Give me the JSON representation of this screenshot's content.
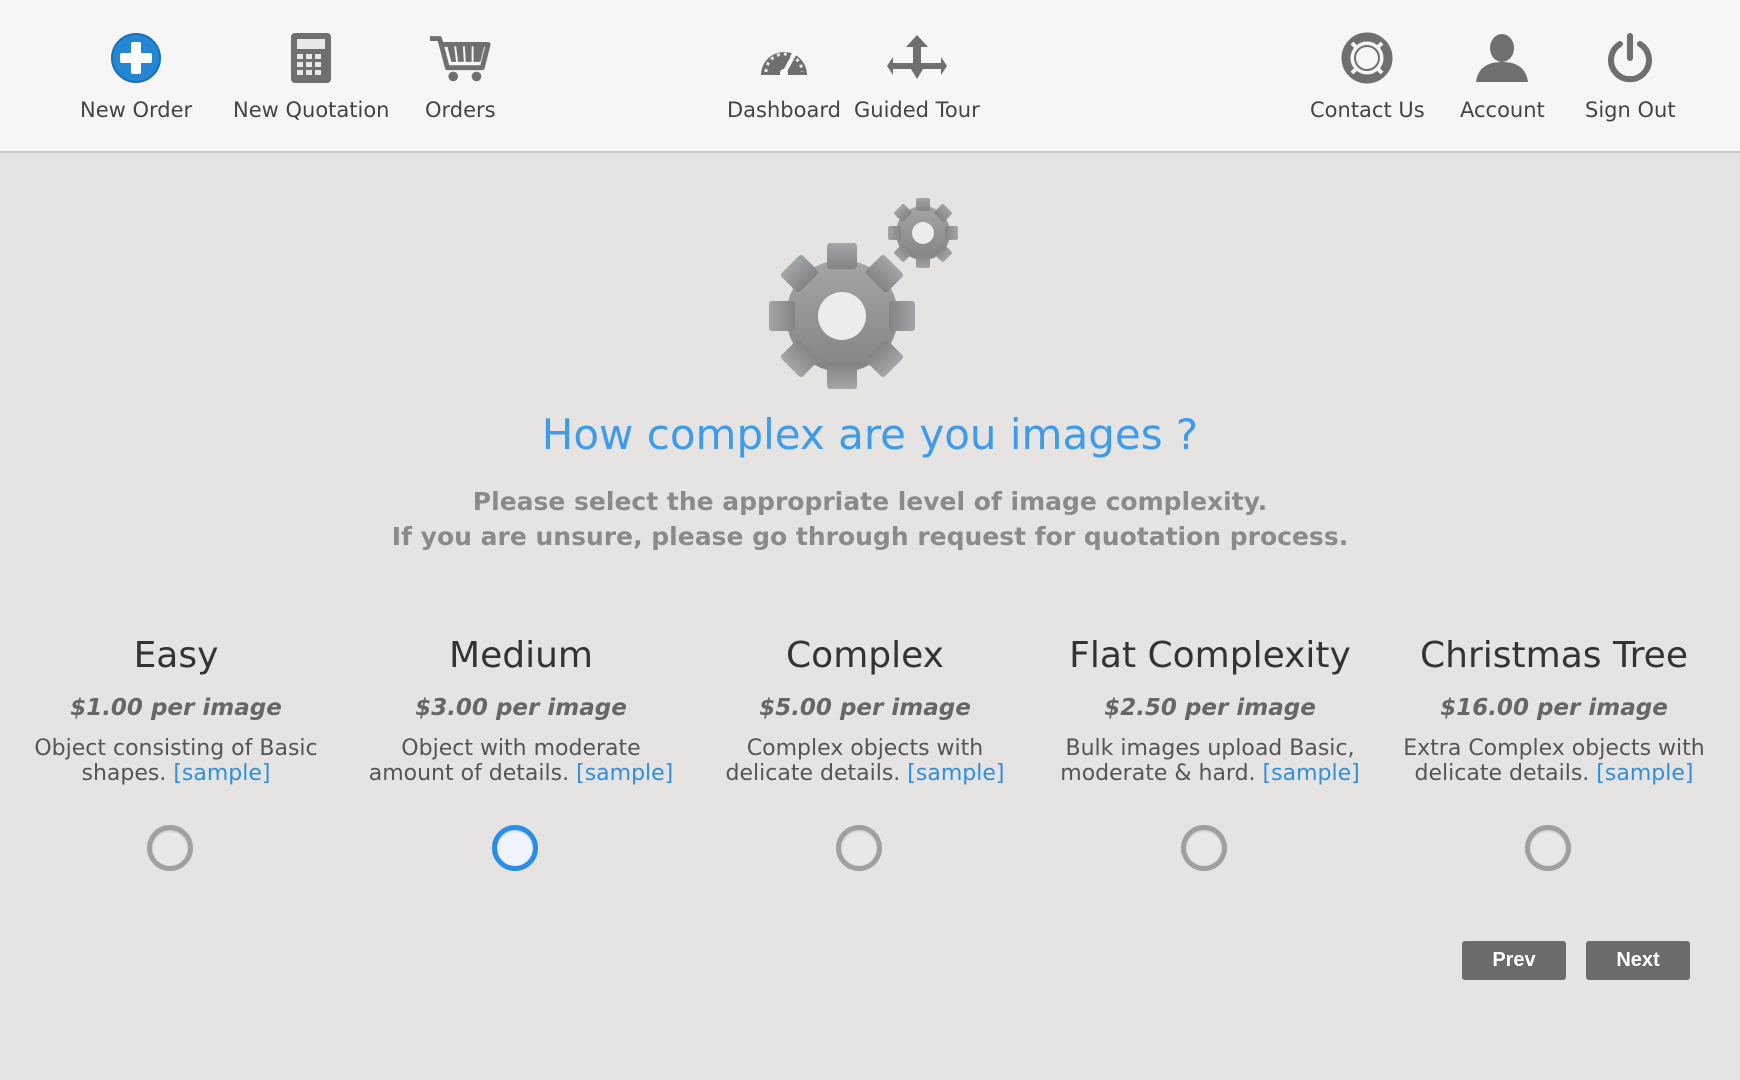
{
  "nav": {
    "new_order": "New Order",
    "new_quotation": "New Quotation",
    "orders": "Orders",
    "dashboard": "Dashboard",
    "guided_tour": "Guided Tour",
    "contact_us": "Contact Us",
    "account": "Account",
    "sign_out": "Sign Out"
  },
  "icons": {
    "new_order": "plus-circle-icon",
    "new_quotation": "calculator-icon",
    "orders": "shopping-cart-icon",
    "dashboard": "speedometer-icon",
    "guided_tour": "move-arrows-icon",
    "contact_us": "lifebuoy-icon",
    "account": "user-icon",
    "sign_out": "power-icon",
    "hero": "gears-icon"
  },
  "main": {
    "title": "How complex are you images ?",
    "subtitle_line1": "Please select the appropriate level of image complexity.",
    "subtitle_line2": "If you are unsure, please go through request for quotation process."
  },
  "options": [
    {
      "name": "Easy",
      "price": "$1.00 per image",
      "desc_line1": "Object consisting of Basic",
      "desc_line2": "shapes.",
      "sample": "[sample]",
      "selected": false
    },
    {
      "name": "Medium",
      "price": "$3.00 per image",
      "desc_line1": "Object with moderate",
      "desc_line2": "amount of details.",
      "sample": "[sample]",
      "selected": true
    },
    {
      "name": "Complex",
      "price": "$5.00 per image",
      "desc_line1": "Complex objects with",
      "desc_line2": "delicate details.",
      "sample": "[sample]",
      "selected": false
    },
    {
      "name": "Flat Complexity",
      "price": "$2.50 per image",
      "desc_line1": "Bulk images upload Basic,",
      "desc_line2": "moderate & hard.",
      "sample": "[sample]",
      "selected": false
    },
    {
      "name": "Christmas Tree",
      "price": "$16.00 per image",
      "desc_line1": "Extra Complex objects with",
      "desc_line2": "delicate details.",
      "sample": "[sample]",
      "selected": false
    }
  ],
  "buttons": {
    "prev": "Prev",
    "next": "Next"
  },
  "colors": {
    "accent": "#3d9be9",
    "selected_radio": "#2a8ee6",
    "button": "#6b6b6b",
    "background": "#e5e4e2",
    "topbar": "#f6f6f6"
  }
}
